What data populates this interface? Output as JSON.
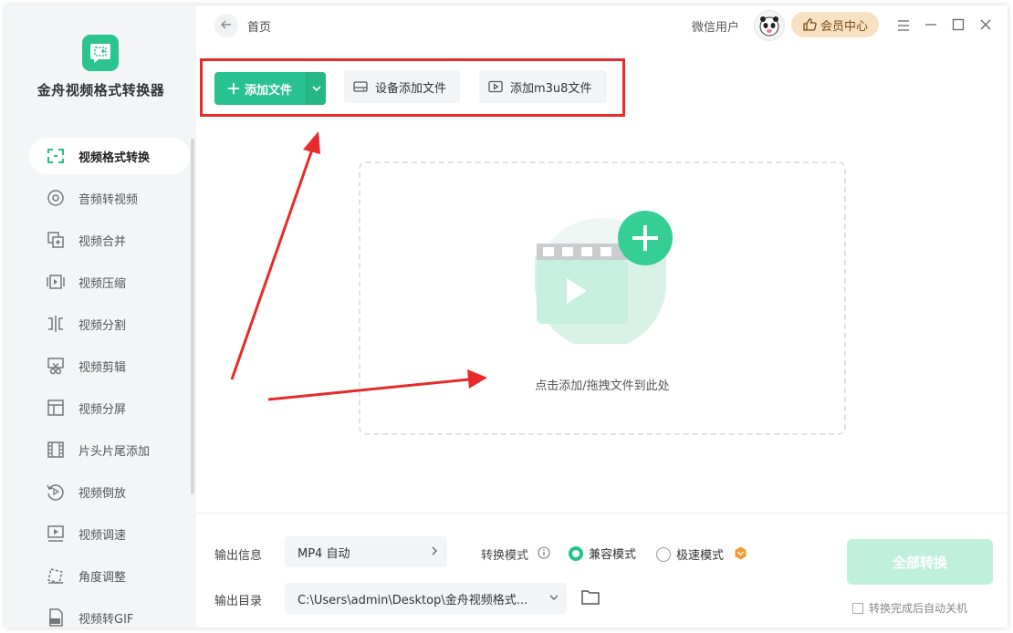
{
  "app": {
    "title": "金舟视频格式转换器"
  },
  "sidebar": {
    "items": [
      {
        "label": "视频格式转换",
        "icon": "convert-icon",
        "active": true
      },
      {
        "label": "音频转视频",
        "icon": "disc-icon"
      },
      {
        "label": "视频合并",
        "icon": "merge-icon"
      },
      {
        "label": "视频压缩",
        "icon": "compress-icon"
      },
      {
        "label": "视频分割",
        "icon": "split-icon"
      },
      {
        "label": "视频剪辑",
        "icon": "scissors-icon"
      },
      {
        "label": "视频分屏",
        "icon": "layout-icon"
      },
      {
        "label": "片头片尾添加",
        "icon": "film-icon"
      },
      {
        "label": "视频倒放",
        "icon": "reverse-icon"
      },
      {
        "label": "视频调速",
        "icon": "speed-icon"
      },
      {
        "label": "角度调整",
        "icon": "rotate-icon"
      },
      {
        "label": "视频转GIF",
        "icon": "gif-icon"
      }
    ]
  },
  "topbar": {
    "breadcrumb": "首页",
    "user_name": "微信用户",
    "vip_label": "会员中心"
  },
  "toolbar": {
    "add_file": "添加文件",
    "device_add": "设备添加文件",
    "add_m3u8": "添加m3u8文件"
  },
  "dropzone": {
    "hint": "点击添加/拖拽文件到此处"
  },
  "bottom": {
    "output_info_label": "输出信息",
    "output_format": "MP4 自动",
    "mode_label": "转换模式",
    "mode_compat": "兼容模式",
    "mode_fast": "极速模式",
    "output_dir_label": "输出目录",
    "output_dir": "C:\\Users\\admin\\Desktop\\金舟视频格式...",
    "convert_all": "全部转换",
    "auto_shutdown": "转换完成后自动关机"
  },
  "colors": {
    "accent": "#28c290",
    "highlight_box": "#e82a2a",
    "vip_bg": "#f6e1c2"
  }
}
